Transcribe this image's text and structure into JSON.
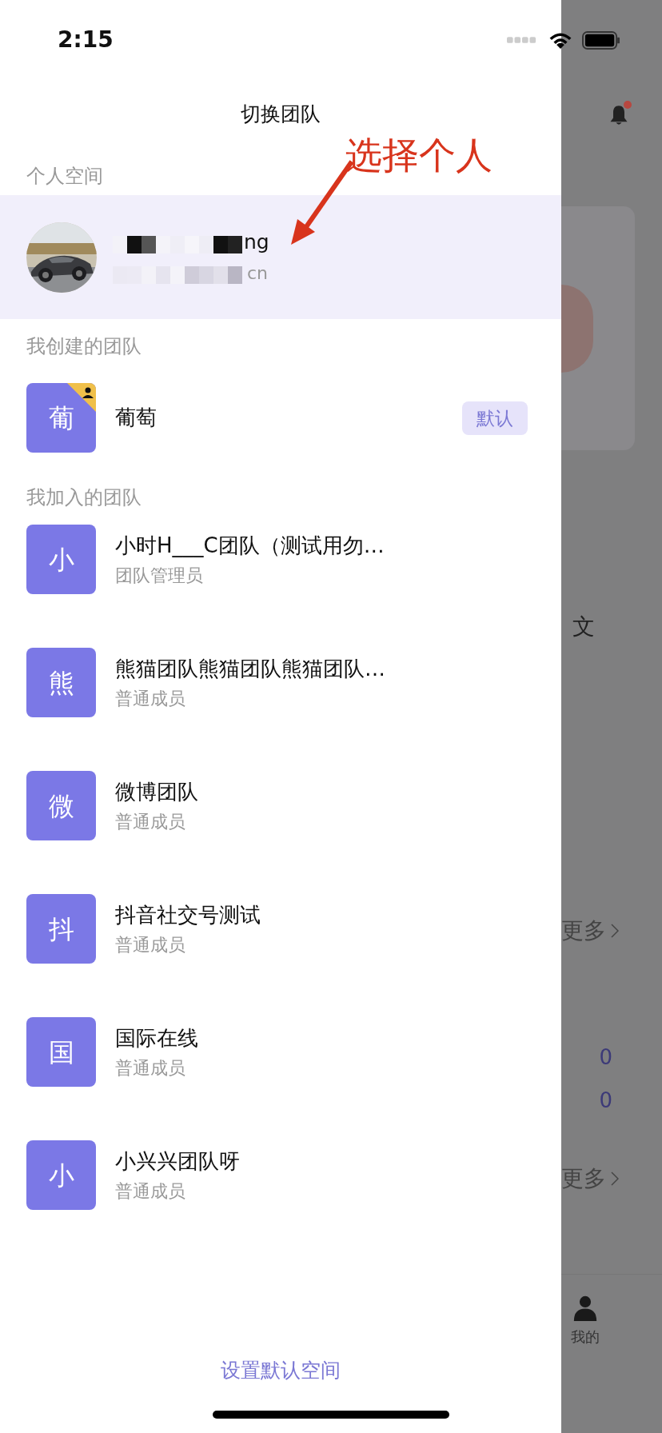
{
  "status_bar": {
    "time": "2:15"
  },
  "drawer": {
    "title": "切换团队",
    "personal_section": {
      "heading": "个人空间",
      "account": {
        "name": "ng",
        "email": "cn",
        "selected": true
      }
    },
    "created_section": {
      "heading": "我创建的团队",
      "teams": [
        {
          "initial": "葡",
          "name": "葡萄",
          "owner": true,
          "badge": "默认"
        }
      ]
    },
    "joined_section": {
      "heading": "我加入的团队",
      "teams": [
        {
          "initial": "小",
          "name": "小时H___C团队（测试用勿…",
          "role": "团队管理员"
        },
        {
          "initial": "熊",
          "name": "熊猫团队熊猫团队熊猫团队…",
          "role": "普通成员"
        },
        {
          "initial": "微",
          "name": "微博团队",
          "role": "普通成员"
        },
        {
          "initial": "抖",
          "name": "抖音社交号测试",
          "role": "普通成员"
        },
        {
          "initial": "国",
          "name": "国际在线",
          "role": "普通成员"
        },
        {
          "initial": "小",
          "name": "小兴兴团队呀",
          "role": "普通成员"
        }
      ]
    },
    "footer_button": "设置默认空间"
  },
  "annotation": {
    "text": "选择个人"
  },
  "background_page": {
    "partial_text": "文",
    "more_links": [
      "更多",
      "更多"
    ],
    "counts": [
      "0",
      "0"
    ],
    "tab_label": "我的",
    "bell_has_dot": true
  }
}
